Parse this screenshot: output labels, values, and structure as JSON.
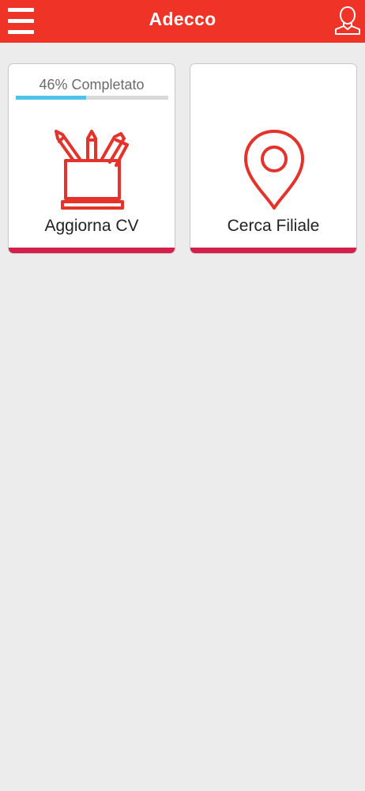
{
  "header": {
    "title": "Adecco",
    "menu_icon": "hamburger-menu-icon",
    "profile_icon": "user-profile-icon",
    "brand_color": "#ef3427"
  },
  "cards": [
    {
      "label": "Aggiorna CV",
      "icon": "pencil-cup-icon",
      "progress_text": "46% Completato",
      "progress_fraction": 0.46,
      "progress_color": "#4ec3ea"
    },
    {
      "label": "Cerca Filiale",
      "icon": "location-pin-icon"
    }
  ],
  "accent_color": "#d41f4b"
}
